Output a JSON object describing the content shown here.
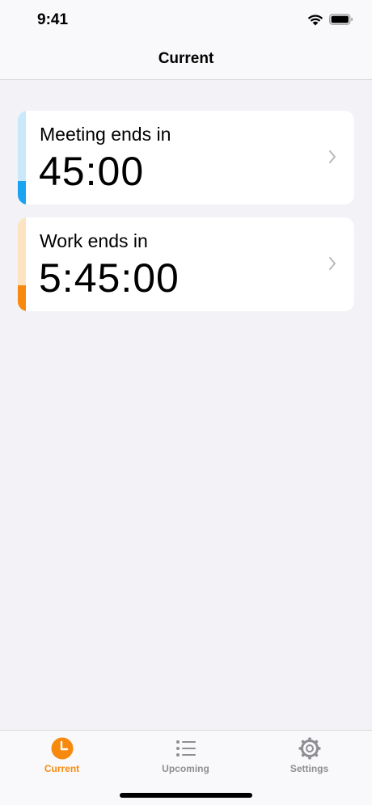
{
  "status_bar": {
    "time": "9:41",
    "wifi_icon": "wifi-icon",
    "battery_icon": "battery-icon"
  },
  "nav": {
    "title": "Current"
  },
  "timers": [
    {
      "label": "Meeting ends in",
      "remaining": "45:00",
      "accent_color": "#1aa3f0",
      "track_color": "#c9e9fb",
      "progress": 0.25,
      "chevron_icon": "chevron-right-icon"
    },
    {
      "label": "Work ends in",
      "remaining": "5:45:00",
      "accent_color": "#f78a0e",
      "track_color": "#fde3c2",
      "progress": 0.28,
      "chevron_icon": "chevron-right-icon"
    }
  ],
  "tabbar": {
    "active_color": "#f78a0e",
    "inactive_color": "#8e8e93",
    "tabs": [
      {
        "label": "Current",
        "icon": "clock-icon",
        "active": true
      },
      {
        "label": "Upcoming",
        "icon": "list-icon",
        "active": false
      },
      {
        "label": "Settings",
        "icon": "gear-icon",
        "active": false
      }
    ]
  }
}
